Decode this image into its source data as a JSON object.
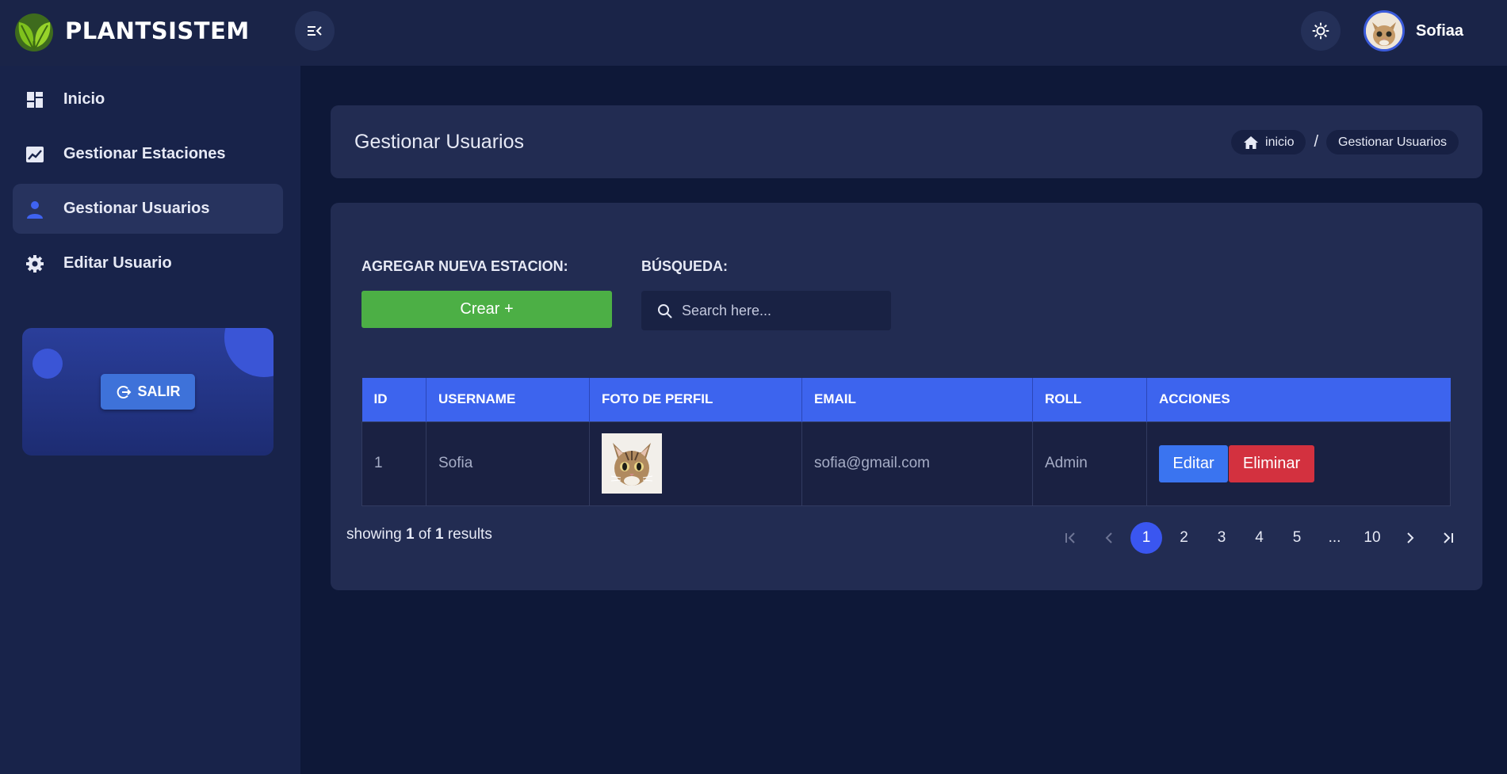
{
  "brand": {
    "name": "PLANTSISTEM"
  },
  "topbar": {
    "user_name": "Sofiaa"
  },
  "sidebar": {
    "items": [
      {
        "label": "Inicio",
        "icon": "dashboard-icon"
      },
      {
        "label": "Gestionar Estaciones",
        "icon": "chart-icon"
      },
      {
        "label": "Gestionar Usuarios",
        "icon": "user-icon",
        "active": true
      },
      {
        "label": "Editar Usuario",
        "icon": "gear-icon"
      }
    ],
    "logout_label": "SALIR"
  },
  "header": {
    "title": "Gestionar Usuarios",
    "breadcrumb": {
      "home": "inicio",
      "separator": "/",
      "current": "Gestionar Usuarios"
    }
  },
  "toolbar": {
    "create_label_title": "AGREGAR NUEVA ESTACION:",
    "create_button": "Crear +",
    "search_label_title": "BÚSQUEDA:",
    "search_placeholder": "Search here..."
  },
  "table": {
    "columns": [
      "ID",
      "USERNAME",
      "FOTO DE PERFIL",
      "EMAIL",
      "ROLL",
      "ACCIONES"
    ],
    "rows": [
      {
        "id": "1",
        "username": "Sofia",
        "email": "sofia@gmail.com",
        "roll": "Admin",
        "edit_label": "Editar",
        "delete_label": "Eliminar"
      }
    ]
  },
  "footer": {
    "showing_prefix": "showing",
    "showing_from": "1",
    "showing_of": "of",
    "showing_total": "1",
    "showing_suffix": "results"
  },
  "pagination": {
    "pages": [
      "1",
      "2",
      "3",
      "4",
      "5",
      "...",
      "10"
    ],
    "current": "1"
  },
  "colors": {
    "page_bg": "#0e1838",
    "topbar_bg": "#1a2448",
    "card_bg": "#222c52",
    "table_header": "#3d64ee",
    "create_green": "#4caf45",
    "edit_blue": "#3a74f0",
    "delete_red": "#d3313f",
    "active_page": "#3a56f0"
  }
}
